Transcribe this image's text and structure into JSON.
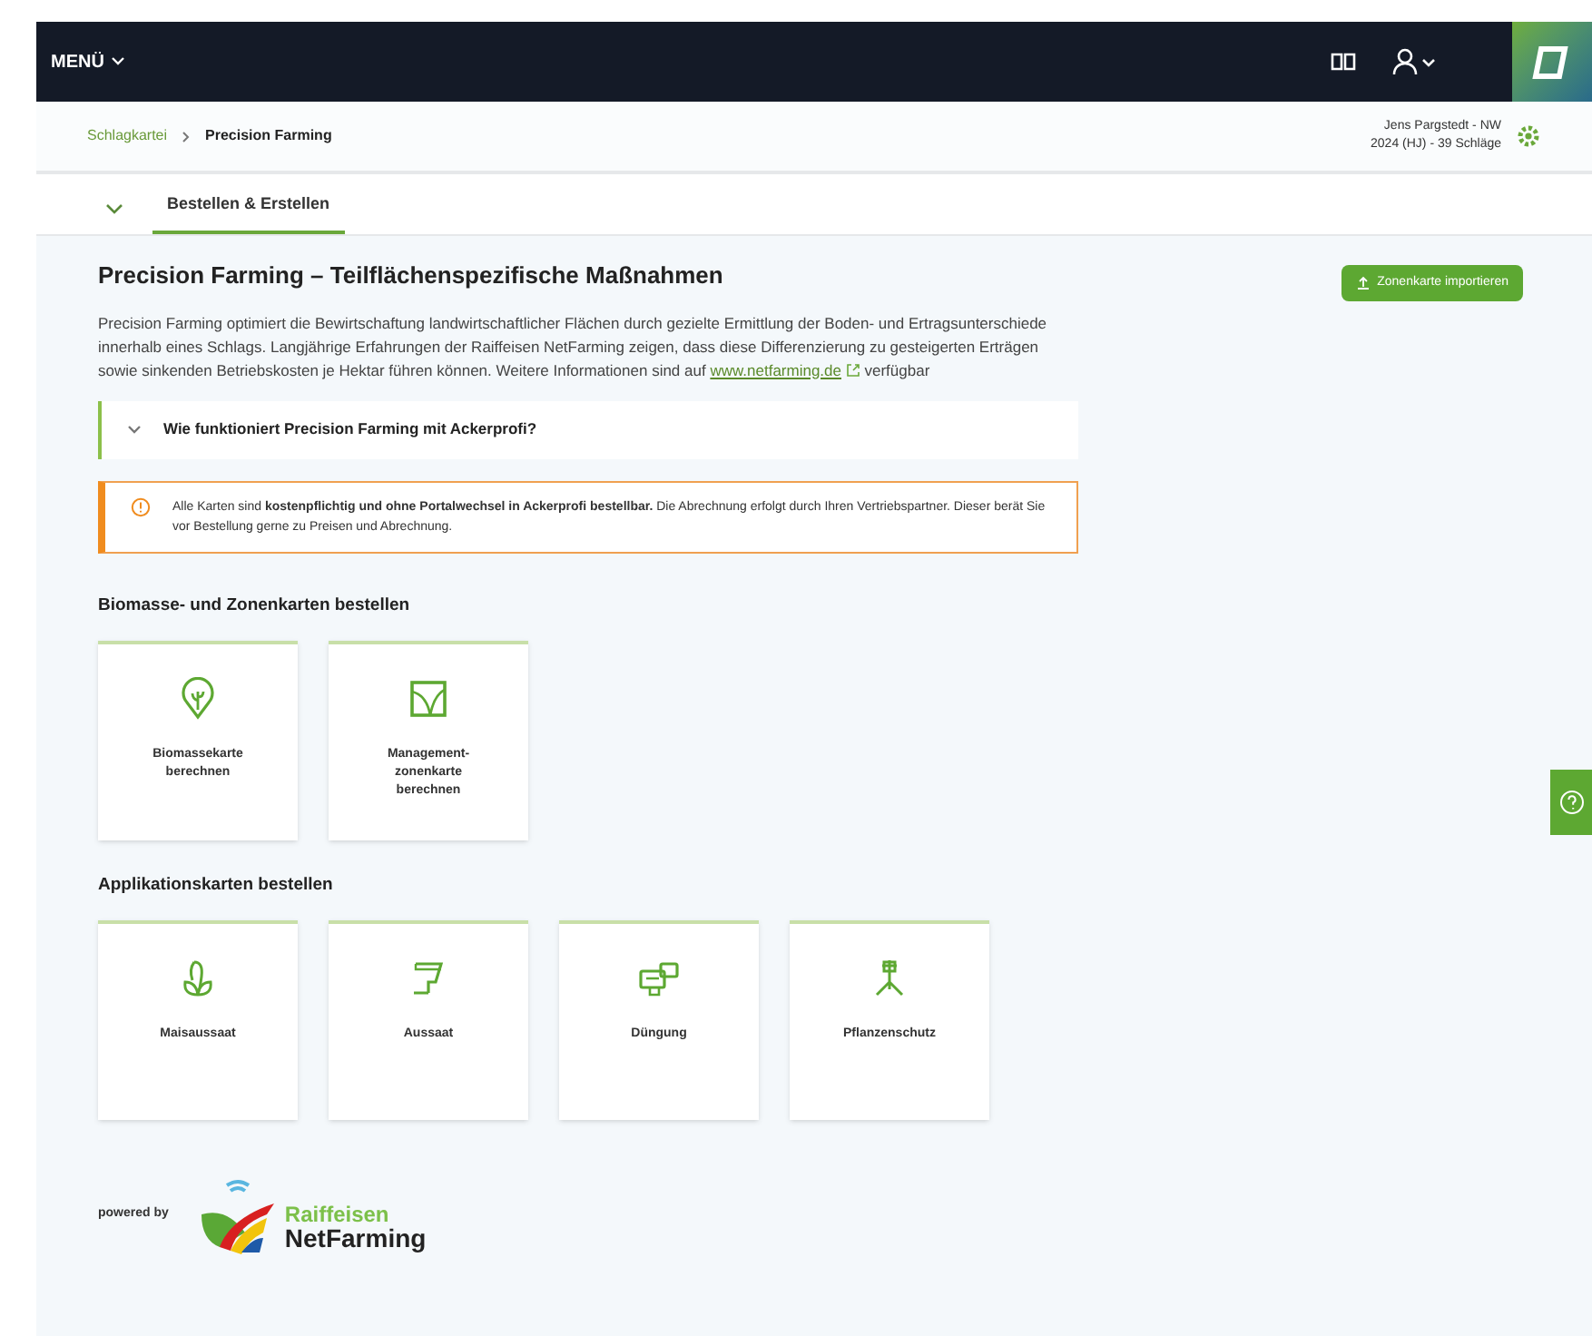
{
  "topbar": {
    "menu": "MENÜ"
  },
  "breadcrumb": [
    "Schlagkartei",
    "Precision Farming"
  ],
  "context": {
    "line_1": "Jens Pargstedt - NW",
    "line_2": "2024 (HJ) - 39 Schläge"
  },
  "tabs": [
    {
      "label": "Bestellen & Erstellen",
      "selected": true
    }
  ],
  "title": "Precision Farming – Teilflächenspezifische Maßnahmen",
  "intro": {
    "text": "Precision Farming optimiert die Bewirtschaftung landwirtschaftlicher Flächen durch gezielte Ermittlung der Boden- und Ertragsunterschiede innerhalb eines Schlags. Langjährige Erfahrungen der Raiffeisen NetFarming zeigen, dass diese Differenzierung zu gesteigerten Erträgen sowie sinkenden Betriebskosten je Hektar führen können. Weitere Informationen sind auf",
    "link": "www.netfarming.de",
    "after": "verfügbar"
  },
  "import_button": "Zonenkarte importieren",
  "accordion": {
    "title": "Wie funktioniert Precision Farming mit Ackerprofi?",
    "expanded": false
  },
  "notice": "Alle Karten sind **kostenpflichtig und ohne Portalwechsel in Ackerprofi bestellbar.** Die Abrechnung erfolgt durch Ihren Vertriebspartner. Dieser berät Sie vor Bestellung gerne zu Preisen und Abrechnung.",
  "sections": [
    {
      "title": "Biomasse- und Zonenkarten bestellen",
      "cards": [
        "Biomassekarte berechnen",
        "Management-zonenkarte berechnen"
      ]
    },
    {
      "title": "Applikationskarten bestellen",
      "cards": [
        "Maisaussaat",
        "Aussaat",
        "Düngung",
        "Pflanzenschutz"
      ]
    }
  ],
  "footer": {
    "powered_by": "powered by",
    "brand_line_1": "Raiffeisen",
    "brand_line_2": "NetFarming"
  }
}
